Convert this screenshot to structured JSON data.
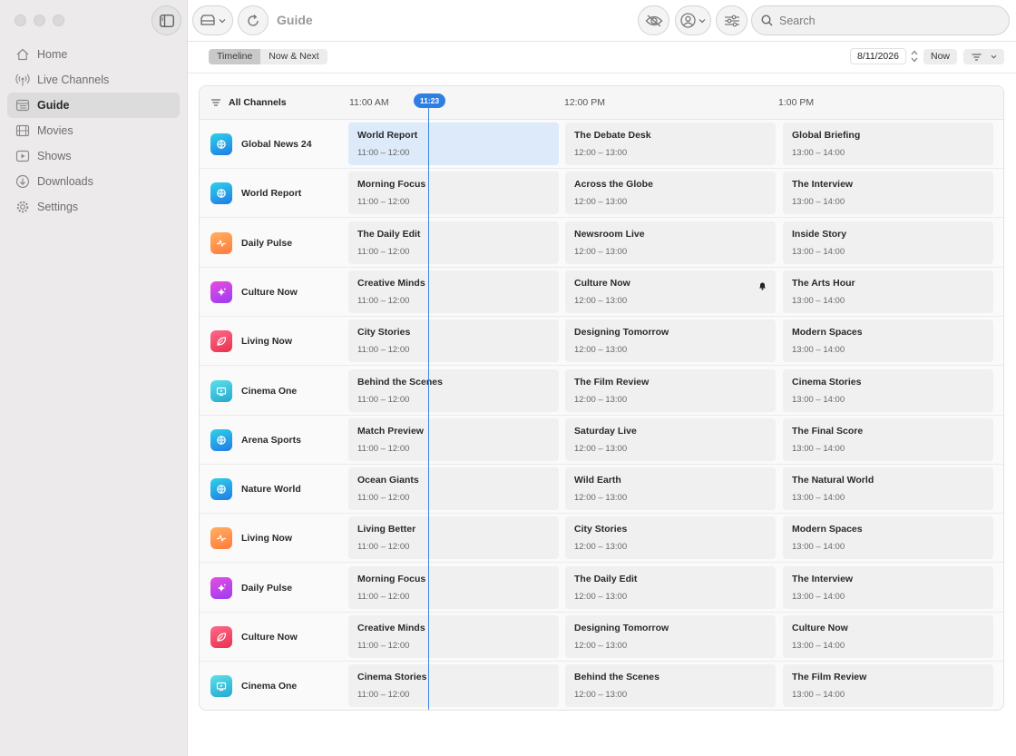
{
  "window": {
    "title": "Guide"
  },
  "sidebar": {
    "items": [
      {
        "label": "Home",
        "icon": "home-icon"
      },
      {
        "label": "Live Channels",
        "icon": "broadcast-icon"
      },
      {
        "label": "Guide",
        "icon": "guide-icon",
        "active": true
      },
      {
        "label": "Movies",
        "icon": "film-icon"
      },
      {
        "label": "Shows",
        "icon": "play-icon"
      },
      {
        "label": "Downloads",
        "icon": "download-icon"
      },
      {
        "label": "Settings",
        "icon": "gear-icon"
      }
    ]
  },
  "toolbar": {
    "search_placeholder": "Search"
  },
  "subbar": {
    "views": [
      "Timeline",
      "Now & Next"
    ],
    "selected_view": "Timeline",
    "date": "8/11/2026",
    "now_label": "Now"
  },
  "guide": {
    "all_channels_label": "All Channels",
    "time_labels": [
      "11:00 AM",
      "12:00 PM",
      "1:00 PM"
    ],
    "now_marker": "11:23",
    "rows": [
      {
        "channel": "Global News 24",
        "icon": "globe-icon",
        "programs": [
          {
            "title": "World Report",
            "time": "11:00 – 12:00"
          },
          {
            "title": "The Debate Desk",
            "time": "12:00 – 13:00"
          },
          {
            "title": "Global Briefing",
            "time": "13:00 – 14:00"
          }
        ]
      },
      {
        "channel": "World Report",
        "icon": "globe-icon",
        "programs": [
          {
            "title": "Morning Focus",
            "time": "11:00 – 12:00"
          },
          {
            "title": "Across the Globe",
            "time": "12:00 – 13:00"
          },
          {
            "title": "The Interview",
            "time": "13:00 – 14:00"
          }
        ]
      },
      {
        "channel": "Daily Pulse",
        "icon": "pulse-icon",
        "programs": [
          {
            "title": "The Daily Edit",
            "time": "11:00 – 12:00"
          },
          {
            "title": "Newsroom Live",
            "time": "12:00 – 13:00"
          },
          {
            "title": "Inside Story",
            "time": "13:00 – 14:00"
          }
        ]
      },
      {
        "channel": "Culture Now",
        "icon": "sparkle-icon",
        "programs": [
          {
            "title": "Creative Minds",
            "time": "11:00 – 12:00"
          },
          {
            "title": "Culture Now",
            "time": "12:00 – 13:00"
          },
          {
            "title": "The Arts Hour",
            "time": "13:00 – 14:00"
          }
        ]
      },
      {
        "channel": "Living Now",
        "icon": "leaf-icon",
        "programs": [
          {
            "title": "City Stories",
            "time": "11:00 – 12:00"
          },
          {
            "title": "Designing Tomorrow",
            "time": "12:00 – 13:00"
          },
          {
            "title": "Modern Spaces",
            "time": "13:00 – 14:00"
          }
        ]
      },
      {
        "channel": "Cinema One",
        "icon": "tv-icon",
        "programs": [
          {
            "title": "Behind the Scenes",
            "time": "11:00 – 12:00"
          },
          {
            "title": "The Film Review",
            "time": "12:00 – 13:00"
          },
          {
            "title": "Cinema Stories",
            "time": "13:00 – 14:00"
          }
        ]
      },
      {
        "channel": "Arena Sports",
        "icon": "globe-icon",
        "programs": [
          {
            "title": "Match Preview",
            "time": "11:00 – 12:00"
          },
          {
            "title": "Saturday Live",
            "time": "12:00 – 13:00"
          },
          {
            "title": "The Final Score",
            "time": "13:00 – 14:00"
          }
        ]
      },
      {
        "channel": "Nature World",
        "icon": "globe-icon",
        "programs": [
          {
            "title": "Ocean Giants",
            "time": "11:00 – 12:00"
          },
          {
            "title": "Wild Earth",
            "time": "12:00 – 13:00"
          },
          {
            "title": "The Natural World",
            "time": "13:00 – 14:00"
          }
        ]
      },
      {
        "channel": "Living Now",
        "icon": "pulse-icon",
        "programs": [
          {
            "title": "Living Better",
            "time": "11:00 – 12:00"
          },
          {
            "title": "City Stories",
            "time": "12:00 – 13:00"
          },
          {
            "title": "Modern Spaces",
            "time": "13:00 – 14:00"
          }
        ]
      },
      {
        "channel": "Daily Pulse",
        "icon": "sparkle-icon",
        "programs": [
          {
            "title": "Morning Focus",
            "time": "11:00 – 12:00"
          },
          {
            "title": "The Daily Edit",
            "time": "12:00 – 13:00"
          },
          {
            "title": "The Interview",
            "time": "13:00 – 14:00"
          }
        ]
      },
      {
        "channel": "Culture Now",
        "icon": "leaf-icon",
        "programs": [
          {
            "title": "Creative Minds",
            "time": "11:00 – 12:00"
          },
          {
            "title": "Designing Tomorrow",
            "time": "12:00 – 13:00"
          },
          {
            "title": "Culture Now",
            "time": "13:00 – 14:00"
          }
        ]
      },
      {
        "channel": "Cinema One",
        "icon": "tv-icon",
        "programs": [
          {
            "title": "Cinema Stories",
            "time": "11:00 – 12:00"
          },
          {
            "title": "Behind the Scenes",
            "time": "12:00 – 13:00"
          },
          {
            "title": "The Film Review",
            "time": "13:00 – 14:00"
          }
        ]
      }
    ]
  },
  "colors": {
    "accent": "#2f7fe3",
    "current_program_bg": "#dceafa",
    "globe_gradient": [
      "#2fd3e8",
      "#1f7ae8"
    ],
    "pulse_gradient": [
      "#ffb060",
      "#ff7a3c"
    ],
    "sparkle_gradient": [
      "#e64de0",
      "#9b3cf0"
    ],
    "leaf_gradient": [
      "#ff6a8a",
      "#e8304e"
    ],
    "tv_gradient": [
      "#5de0ea",
      "#22a8cf"
    ]
  }
}
